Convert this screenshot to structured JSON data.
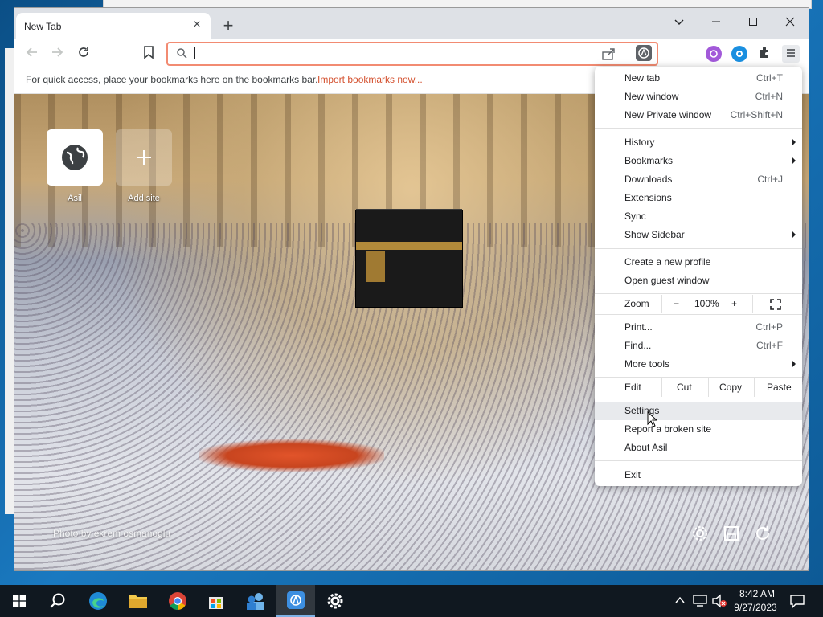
{
  "browser": {
    "tab_title": "New Tab",
    "bookmarks_bar": {
      "hint": "For quick access, place your bookmarks here on the bookmarks bar.",
      "import_link": "Import bookmarks now..."
    },
    "tiles": [
      {
        "label": "Asil",
        "icon": "globe-icon"
      },
      {
        "label": "Add site",
        "icon": "plus-icon"
      }
    ],
    "photo_credit": "Photo by ekrem osmanoglu"
  },
  "menu": {
    "items_group1": [
      {
        "label": "New tab",
        "shortcut": "Ctrl+T"
      },
      {
        "label": "New window",
        "shortcut": "Ctrl+N"
      },
      {
        "label": "New Private window",
        "shortcut": "Ctrl+Shift+N"
      }
    ],
    "items_group2": [
      {
        "label": "History",
        "shortcut": "",
        "submenu": true
      },
      {
        "label": "Bookmarks",
        "shortcut": "",
        "submenu": true
      },
      {
        "label": "Downloads",
        "shortcut": "Ctrl+J",
        "submenu": false
      },
      {
        "label": "Extensions",
        "shortcut": "",
        "submenu": false
      },
      {
        "label": "Sync",
        "shortcut": "",
        "submenu": false
      },
      {
        "label": "Show Sidebar",
        "shortcut": "",
        "submenu": true
      }
    ],
    "items_group3": [
      {
        "label": "Create a new profile"
      },
      {
        "label": "Open guest window"
      }
    ],
    "zoom": {
      "label": "Zoom",
      "minus": "−",
      "value": "100%",
      "plus": "+"
    },
    "items_group4": [
      {
        "label": "Print...",
        "shortcut": "Ctrl+P",
        "submenu": false
      },
      {
        "label": "Find...",
        "shortcut": "Ctrl+F",
        "submenu": false
      },
      {
        "label": "More tools",
        "shortcut": "",
        "submenu": true
      }
    ],
    "edit": {
      "label": "Edit",
      "cut": "Cut",
      "copy": "Copy",
      "paste": "Paste"
    },
    "items_group5": [
      {
        "label": "Settings",
        "highlighted": true
      },
      {
        "label": "Report a broken site",
        "highlighted": false
      },
      {
        "label": "About Asil",
        "highlighted": false
      }
    ],
    "exit": "Exit"
  },
  "taskbar": {
    "apps": [
      "start-icon",
      "search-icon",
      "edge-icon",
      "file-explorer-icon",
      "chrome-icon",
      "store-icon",
      "people-icon",
      "asil-browser-icon",
      "settings-icon"
    ],
    "time": "8:42 AM",
    "date": "9/27/2023"
  },
  "colors": {
    "accent": "#d4512f",
    "taskbar": "#101820",
    "menu_highlight": "#e8eaed"
  }
}
